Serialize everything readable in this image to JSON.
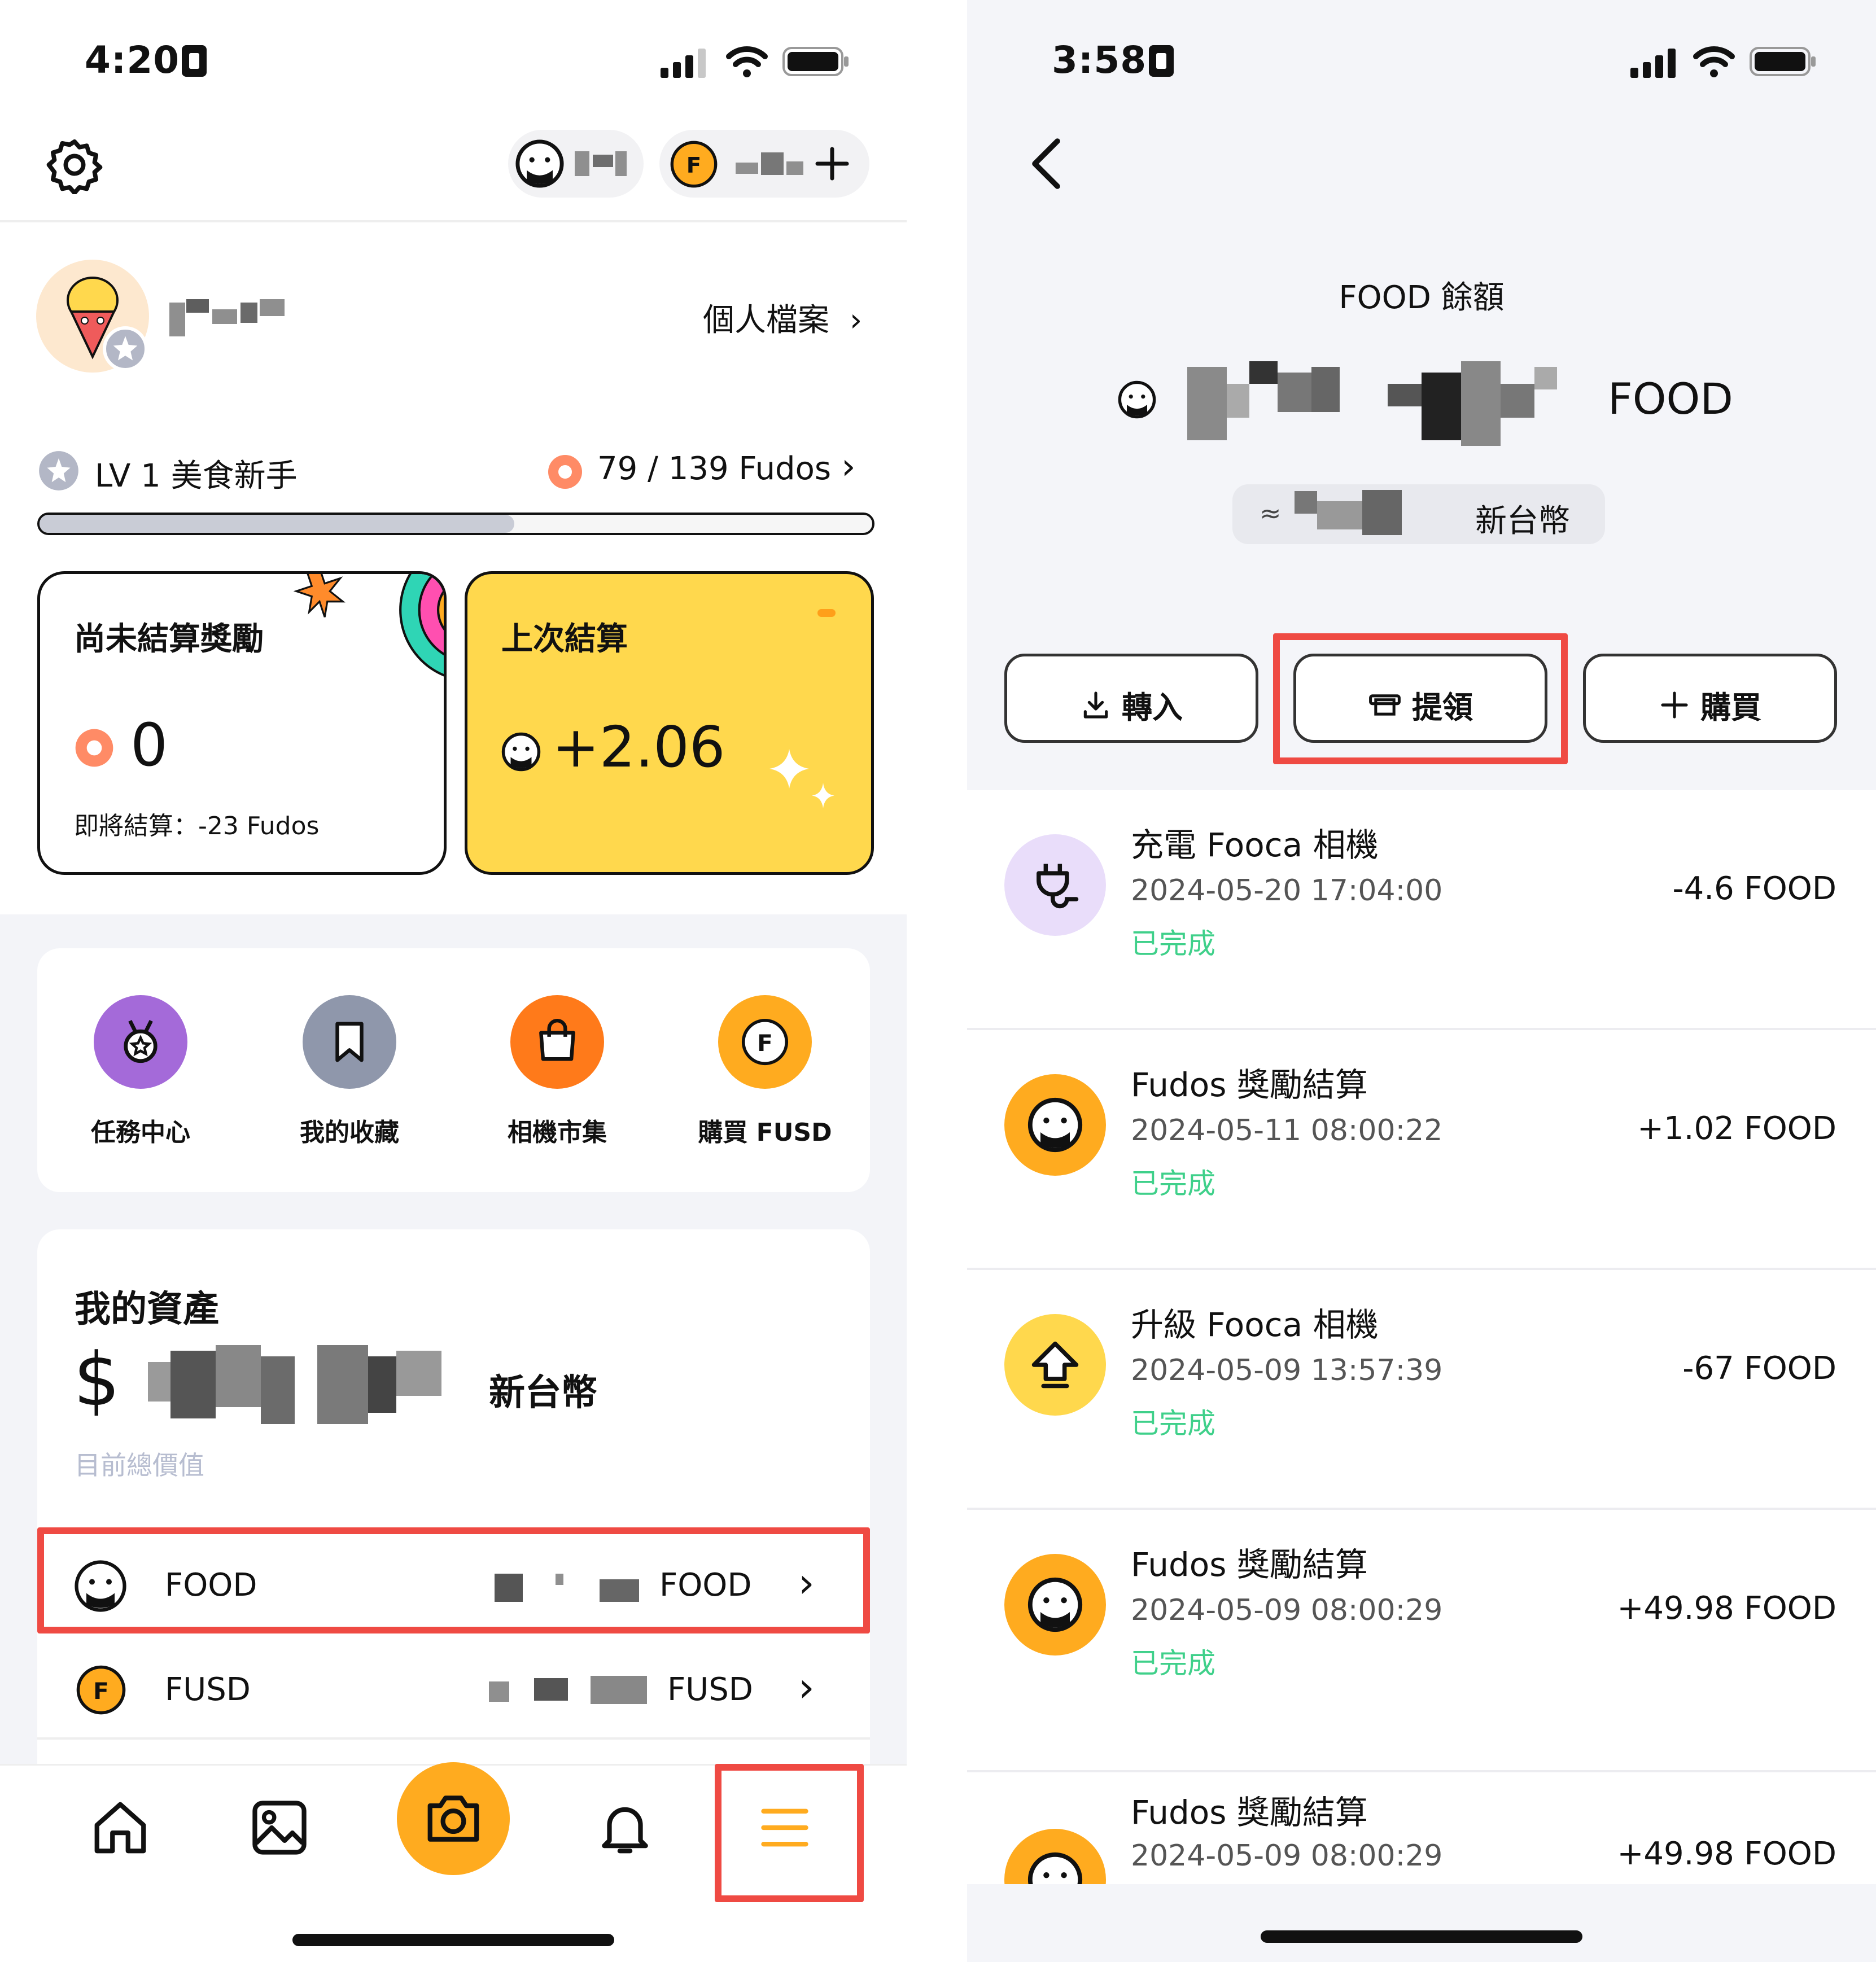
{
  "left_screen": {
    "status_time": "4:20",
    "user": {
      "profile_link": "個人檔案"
    },
    "level": {
      "label": "LV 1 美食新手",
      "progress_text": "79 / 139 Fudos",
      "progress_fraction": 0.57
    },
    "cards": {
      "unsettled": {
        "title": "尚未結算獎勵",
        "value": "0",
        "note": "即將結算：-23 Fudos"
      },
      "last": {
        "title": "上次結算",
        "value": "+2.06"
      }
    },
    "shortcuts": [
      {
        "label": "任務中心",
        "icon": "medal-icon",
        "color": "#a46ad9"
      },
      {
        "label": "我的收藏",
        "icon": "bookmark-icon",
        "color": "#8f97ab"
      },
      {
        "label": "相機市集",
        "icon": "shopping-bag-icon",
        "color": "#ff7a1a"
      },
      {
        "label": "購買 FUSD",
        "icon": "fusd-coin-icon",
        "color": "#ffab1f"
      }
    ],
    "assets": {
      "title": "我的資產",
      "currency_symbol": "$",
      "currency_unit": "新台幣",
      "caption": "目前總價值",
      "rows": [
        {
          "name": "FOOD",
          "unit": "FOOD",
          "highlighted": true
        },
        {
          "name": "FUSD",
          "unit": "FUSD",
          "highlighted": false
        }
      ]
    },
    "tabbar": [
      "home-icon",
      "gallery-icon",
      "camera-icon",
      "bell-icon",
      "menu-icon"
    ],
    "colors": {
      "accent": "#ffab1f",
      "highlight": "#ef4a43",
      "card_yellow": "#ffd84d"
    }
  },
  "right_screen": {
    "status_time": "3:58",
    "balance": {
      "title": "FOOD 餘額",
      "unit": "FOOD",
      "approx_prefix": "≈",
      "fiat_unit": "新台幣"
    },
    "actions": [
      {
        "label": "轉入",
        "icon": "download-icon"
      },
      {
        "label": "提領",
        "icon": "withdraw-icon",
        "highlighted": true
      },
      {
        "label": "購買",
        "icon": "plus-icon"
      }
    ],
    "transactions": [
      {
        "title": "充電 Fooca 相機",
        "date": "2024-05-20 17:04:00",
        "status": "已完成",
        "amount": "-4.6 FOOD",
        "icon": "plug-icon"
      },
      {
        "title": "Fudos 獎勵結算",
        "date": "2024-05-11 08:00:22",
        "status": "已完成",
        "amount": "+1.02 FOOD",
        "icon": "food-face-icon"
      },
      {
        "title": "升級 Fooca 相機",
        "date": "2024-05-09 13:57:39",
        "status": "已完成",
        "amount": "-67 FOOD",
        "icon": "upgrade-arrow-icon"
      },
      {
        "title": "Fudos 獎勵結算",
        "date": "2024-05-09 08:00:29",
        "status": "已完成",
        "amount": "+49.98 FOOD",
        "icon": "food-face-icon"
      },
      {
        "title": "Fudos 獎勵結算",
        "date": "2024-05-09 08:00:29",
        "status": "",
        "amount": "+49.98 FOOD",
        "icon": "food-face-icon"
      }
    ]
  }
}
